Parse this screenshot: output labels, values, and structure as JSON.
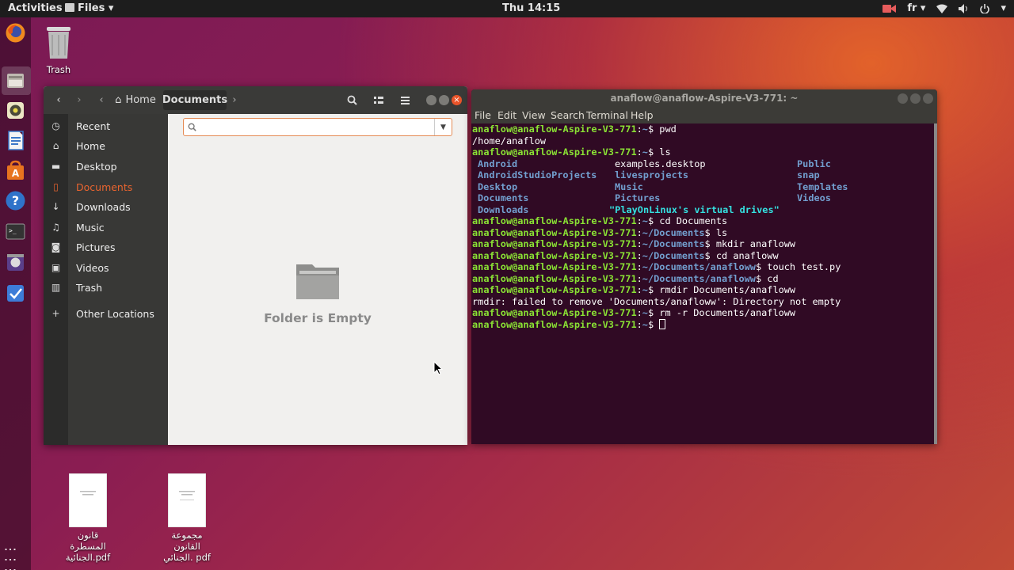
{
  "topbar": {
    "activities": "Activities",
    "app_menu": "Files ▾",
    "clock": "Thu 14:15",
    "lang": "fr ▾"
  },
  "dock": {
    "icons": [
      "firefox-icon",
      "files-icon",
      "rhythmbox-icon",
      "writer-icon",
      "software-icon",
      "help-icon",
      "terminal-icon",
      "video-icon",
      "tasks-icon"
    ],
    "apps_grid": "⋮⋮⋮"
  },
  "desktop": {
    "trash_label": "Trash",
    "file1_label": "قانون المسطرة الجنائية.pdf",
    "file2_label": "مجموعة القانون الجنائي. pdf"
  },
  "files": {
    "path": {
      "home": "Home",
      "current": "Documents"
    },
    "sidebar": [
      {
        "label": "Recent",
        "icon": "clock-icon",
        "glyph": "◷"
      },
      {
        "label": "Home",
        "icon": "home-icon",
        "glyph": "⌂"
      },
      {
        "label": "Desktop",
        "icon": "folder-icon",
        "glyph": "▬"
      },
      {
        "label": "Documents",
        "icon": "document-icon",
        "glyph": "▯"
      },
      {
        "label": "Downloads",
        "icon": "download-icon",
        "glyph": "↓"
      },
      {
        "label": "Music",
        "icon": "music-icon",
        "glyph": "♫"
      },
      {
        "label": "Pictures",
        "icon": "camera-icon",
        "glyph": "◙"
      },
      {
        "label": "Videos",
        "icon": "video-icon",
        "glyph": "▣"
      },
      {
        "label": "Trash",
        "icon": "trash-icon",
        "glyph": "▥"
      },
      {
        "label": "Other Locations",
        "icon": "plus-icon",
        "glyph": "+"
      }
    ],
    "active": "Documents",
    "empty_text": "Folder is Empty"
  },
  "terminal": {
    "title": "anaflow@anaflow-Aspire-V3-771: ~",
    "menu": [
      "File",
      "Edit",
      "View",
      "Search",
      "Terminal",
      "Help"
    ],
    "prompt_user": "anaflow@anaflow-Aspire-V3-771",
    "lines": [
      {
        "path": "~",
        "cmd": "pwd"
      },
      {
        "out": "/home/anaflow"
      },
      {
        "path": "~",
        "cmd": "ls"
      },
      {
        "ls": [
          [
            "Android",
            "examples.desktop",
            "Public"
          ],
          [
            "AndroidStudioProjects",
            "livesprojects",
            "snap"
          ],
          [
            "Desktop",
            "Music",
            "Templates"
          ],
          [
            "Documents",
            "Pictures",
            "Videos"
          ],
          [
            "Downloads",
            "\"PlayOnLinux's virtual drives\"",
            ""
          ]
        ]
      },
      {
        "path": "~",
        "cmd": "cd Documents"
      },
      {
        "path": "~/Documents",
        "cmd": "ls"
      },
      {
        "path": "~/Documents",
        "cmd": "mkdir anafloww"
      },
      {
        "path": "~/Documents",
        "cmd": "cd anafloww"
      },
      {
        "path": "~/Documents/anafloww",
        "cmd": "touch test.py"
      },
      {
        "path": "~/Documents/anafloww",
        "cmd": "cd"
      },
      {
        "path": "~",
        "cmd": "rmdir Documents/anafloww"
      },
      {
        "out": "rmdir: failed to remove 'Documents/anafloww': Directory not empty"
      },
      {
        "path": "~",
        "cmd": "rm -r Documents/anafloww"
      },
      {
        "path": "~",
        "cmd": "",
        "cursor": true
      }
    ]
  }
}
